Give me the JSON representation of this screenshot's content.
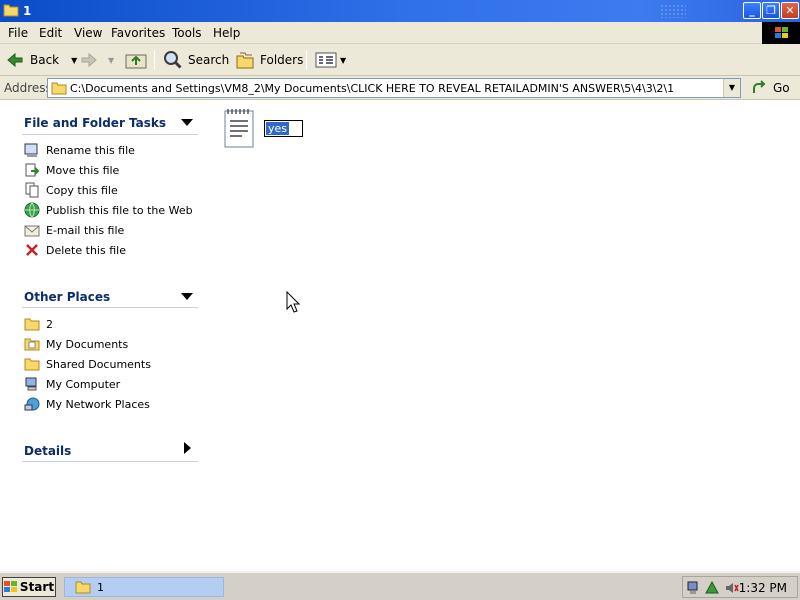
{
  "window": {
    "title": "1"
  },
  "menu": {
    "items": [
      "File",
      "Edit",
      "View",
      "Favorites",
      "Tools",
      "Help"
    ]
  },
  "toolbar": {
    "back_label": "Back",
    "search_label": "Search",
    "folders_label": "Folders"
  },
  "address": {
    "label": "Address",
    "value": "C:\\Documents and Settings\\VM8_2\\My Documents\\CLICK HERE TO REVEAL RETAILADMIN'S ANSWER\\5\\4\\3\\2\\1",
    "go_label": "Go"
  },
  "tasks": {
    "title": "File and Folder Tasks",
    "items": [
      {
        "label": "Rename this file",
        "icon": "rename-icon"
      },
      {
        "label": "Move this file",
        "icon": "move-icon"
      },
      {
        "label": "Copy this file",
        "icon": "copy-icon"
      },
      {
        "label": "Publish this file to the Web",
        "icon": "globe-icon"
      },
      {
        "label": "E-mail this file",
        "icon": "email-icon"
      },
      {
        "label": "Delete this file",
        "icon": "delete-icon"
      }
    ]
  },
  "other_places": {
    "title": "Other Places",
    "items": [
      {
        "label": "2",
        "icon": "folder-icon"
      },
      {
        "label": "My Documents",
        "icon": "my-documents-icon"
      },
      {
        "label": "Shared Documents",
        "icon": "folder-icon"
      },
      {
        "label": "My Computer",
        "icon": "computer-icon"
      },
      {
        "label": "My Network Places",
        "icon": "network-icon"
      }
    ]
  },
  "details": {
    "title": "Details"
  },
  "file": {
    "rename_value": "yes"
  },
  "taskbar": {
    "start_label": "Start",
    "task_label": "1",
    "clock": "1:32 PM"
  },
  "colors": {
    "titlebar": "#0a4cc8",
    "panel_heading": "#0c2c6b",
    "selection": "#316ac5"
  }
}
